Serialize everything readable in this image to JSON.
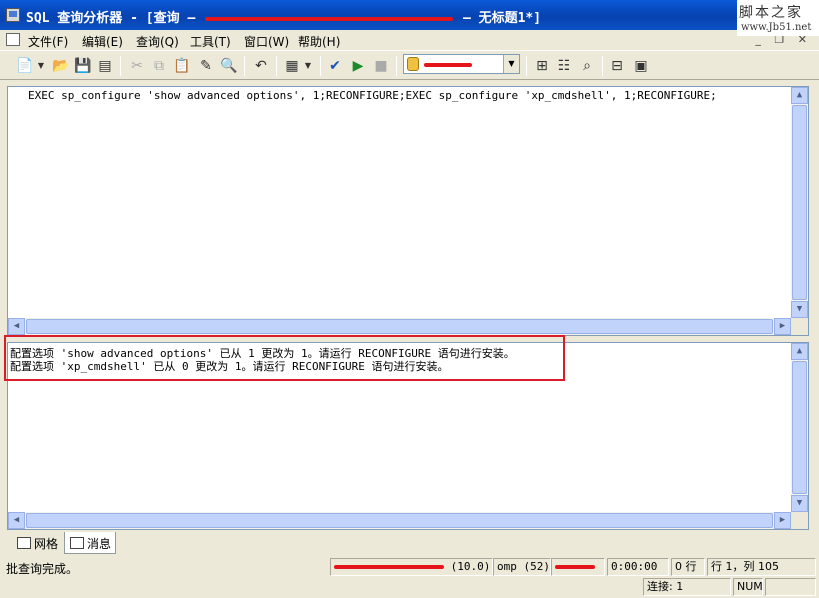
{
  "window": {
    "title_prefix": "SQL 查询分析器 - [查询 —",
    "title_suffix": "— 无标题1*]"
  },
  "watermark": {
    "chars": "脚本之家",
    "url": "www.Jb51.net"
  },
  "menu": {
    "items": [
      "文件(F)",
      "编辑(E)",
      "查询(Q)",
      "工具(T)",
      "窗口(W)",
      "帮助(H)"
    ]
  },
  "mdi_controls": {
    "minimize": "_",
    "restore": "❐",
    "close": "✕"
  },
  "toolbar": {
    "icons": [
      "new-query-icon",
      "dropdown-arrow-icon",
      "open-icon",
      "save-icon",
      "insert-template-icon",
      "cut-icon",
      "copy-icon",
      "paste-icon",
      "clear-icon",
      "find-icon",
      "undo-icon",
      "results-mode-icon",
      "dropdown-arrow-icon",
      "parse-icon",
      "execute-icon",
      "stop-icon",
      "estimated-plan-icon",
      "object-browser-icon",
      "object-search-icon",
      "current-connection-icon",
      "show-results-pane-icon"
    ]
  },
  "editor": {
    "code": "EXEC sp_configure 'show advanced options', 1;RECONFIGURE;EXEC sp_configure 'xp_cmdshell', 1;RECONFIGURE;"
  },
  "results": {
    "messages": [
      "配置选项 'show advanced options' 已从 1 更改为 1。请运行 RECONFIGURE 语句进行安装。",
      "配置选项 'xp_cmdshell' 已从 0 更改为 1。请运行 RECONFIGURE 语句进行安装。"
    ]
  },
  "tabs": [
    {
      "label": "网格",
      "active": false
    },
    {
      "label": "消息",
      "active": true
    }
  ],
  "status": {
    "main": "批查询完成。",
    "server_version": "(10.0)",
    "user": "omp (52)",
    "time": "0:00:00",
    "rows": "0 行",
    "position": "行 1，列 105",
    "connections": "连接: 1",
    "num": "NUM"
  }
}
